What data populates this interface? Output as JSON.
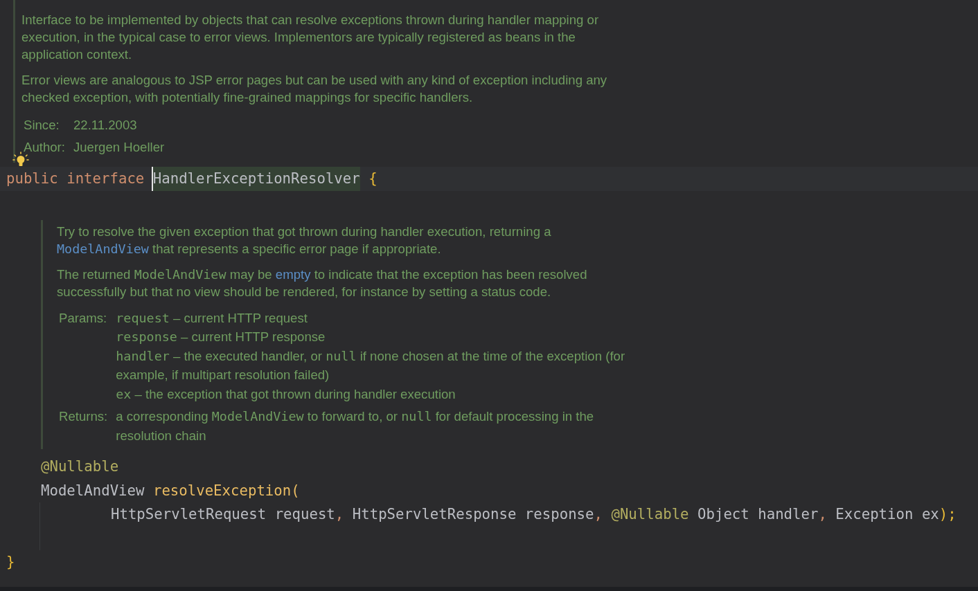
{
  "class_doc": {
    "paragraphs": [
      [
        [
          {
            "kind": "text",
            "text": "Interface to be implemented by objects that can resolve exceptions thrown during handler mapping or"
          }
        ],
        [
          {
            "kind": "text",
            "text": "execution, in the typical case to error views. Implementors are typically registered as beans in the"
          }
        ],
        [
          {
            "kind": "text",
            "text": "application context."
          }
        ]
      ],
      [
        [
          {
            "kind": "text",
            "text": "Error views are analogous to JSP error pages but can be used with any kind of exception including any"
          }
        ],
        [
          {
            "kind": "text",
            "text": "checked exception, with potentially fine-grained mappings for specific handlers."
          }
        ]
      ]
    ],
    "tags": [
      {
        "label": "Since:",
        "entries": [
          [
            [
              {
                "kind": "text",
                "text": "22.11.2003"
              }
            ]
          ]
        ]
      },
      {
        "label": "Author:",
        "entries": [
          [
            [
              {
                "kind": "text",
                "text": "Juergen Hoeller"
              }
            ]
          ]
        ]
      }
    ]
  },
  "declaration": {
    "kind": "top",
    "tokens": [
      {
        "kind": "keyword",
        "text": "public"
      },
      {
        "kind": "keyword",
        "text": "interface"
      },
      {
        "kind": "usage",
        "text": "HandlerExceptionResolver"
      },
      {
        "kind": "brace",
        "text": "{"
      }
    ]
  },
  "method_doc": {
    "paragraphs": [
      [
        [
          {
            "kind": "text",
            "text": "Try to resolve the given exception that got thrown during handler execution, returning a"
          }
        ],
        [
          {
            "kind": "code-link",
            "text": "ModelAndView"
          },
          {
            "kind": "text",
            "text": "that represents a specific error page if appropriate."
          }
        ]
      ],
      [
        [
          {
            "kind": "text",
            "text": "The returned"
          },
          {
            "kind": "code",
            "text": "ModelAndView"
          },
          {
            "kind": "text",
            "text": "may be"
          },
          {
            "kind": "link",
            "text": "empty"
          },
          {
            "kind": "text",
            "text": "to indicate that the exception has been resolved"
          }
        ],
        [
          {
            "kind": "text",
            "text": "successfully but that no view should be rendered, for instance by setting a status code."
          }
        ]
      ]
    ],
    "tags": [
      {
        "label": "Params:",
        "entries": [
          [
            [
              {
                "kind": "code",
                "text": "request"
              },
              {
                "kind": "text",
                "text": "– current HTTP request"
              }
            ]
          ],
          [
            [
              {
                "kind": "code",
                "text": "response"
              },
              {
                "kind": "text",
                "text": "– current HTTP response"
              }
            ]
          ],
          [
            [
              {
                "kind": "code",
                "text": "handler"
              },
              {
                "kind": "text",
                "text": "– the executed handler, or"
              },
              {
                "kind": "code",
                "text": "null"
              },
              {
                "kind": "text",
                "text": "if none chosen at the time of the exception (for"
              }
            ],
            [
              {
                "kind": "text",
                "text": "example, if multipart resolution failed)"
              }
            ]
          ],
          [
            [
              {
                "kind": "code",
                "text": "ex"
              },
              {
                "kind": "text",
                "text": "– the exception that got thrown during handler execution"
              }
            ]
          ]
        ]
      },
      {
        "label": "Returns:",
        "entries": [
          [
            [
              {
                "kind": "text",
                "text": "a corresponding"
              },
              {
                "kind": "code",
                "text": "ModelAndView"
              },
              {
                "kind": "text",
                "text": "to forward to, or"
              },
              {
                "kind": "code",
                "text": "null"
              },
              {
                "kind": "text",
                "text": "for default processing in the"
              }
            ],
            [
              {
                "kind": "text",
                "text": "resolution chain"
              }
            ]
          ]
        ]
      }
    ]
  },
  "method_code": [
    {
      "kind": "member",
      "tokens": [
        {
          "kind": "annotation",
          "text": "@Nullable"
        }
      ]
    },
    {
      "kind": "member",
      "tokens": [
        {
          "kind": "plain",
          "text": "ModelAndView"
        },
        {
          "kind": "method",
          "text": "resolveException("
        }
      ]
    },
    {
      "kind": "continuation",
      "tokens": [
        {
          "kind": "plain",
          "text": "HttpServletRequest request"
        },
        {
          "kind": "comma",
          "text": ","
        },
        {
          "kind": "plain",
          "text": "HttpServletResponse response"
        },
        {
          "kind": "comma",
          "text": ","
        },
        {
          "kind": "annotation",
          "text": "@Nullable"
        },
        {
          "kind": "plain",
          "text": "Object handler"
        },
        {
          "kind": "comma",
          "text": ","
        },
        {
          "kind": "plain",
          "text": "Exception ex"
        },
        {
          "kind": "brace",
          "text": ");"
        }
      ]
    },
    {
      "kind": "blank"
    },
    {
      "kind": "top",
      "tokens": [
        {
          "kind": "brace",
          "text": "}"
        }
      ]
    }
  ]
}
